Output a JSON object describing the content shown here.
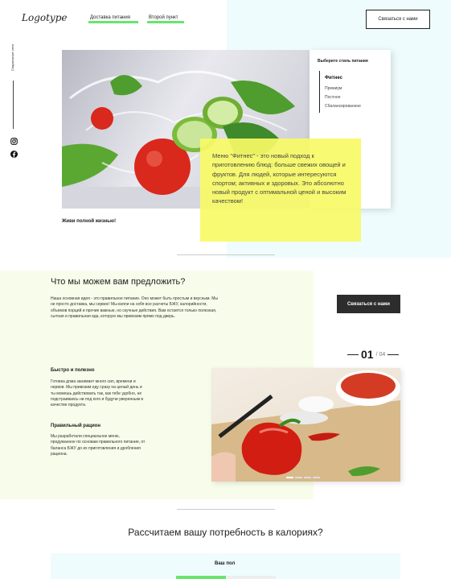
{
  "header": {
    "logo": "Logotype",
    "nav": [
      {
        "label": "Доставка питания"
      },
      {
        "label": "Второй пункт"
      }
    ],
    "contact_button": "Связаться с нами"
  },
  "sidebar": {
    "vertical_text": "Социальные сети",
    "social": [
      {
        "icon": "instagram-icon"
      },
      {
        "icon": "facebook-icon"
      }
    ]
  },
  "hero": {
    "panel_title": "Выберите стиль питания",
    "styles": [
      {
        "label": "Фитнес",
        "active": true
      },
      {
        "label": "Премиум",
        "active": false
      },
      {
        "label": "Постное",
        "active": false
      },
      {
        "label": "Сбалансированное",
        "active": false
      }
    ],
    "description": "Меню \"Фитнес\" - это новый подход к приготовлению блюд: больше свежих овощей и фруктов. Для людей, которые интересуются спортом; активных и здоровых. Это абсолютно новый продукт с оптимальной ценой и высоким качеством!",
    "tagline": "Живи полной жизнью!",
    "highlight_color": "#f7fa66"
  },
  "offer": {
    "title": "Что мы можем вам предложить?",
    "intro": "Наша основная идея - это правильное питание. Оно может быть простым и вкусным. Мы не просто доставка, мы сервис! Мы взяли на себя все расчеты БЖУ, калорийности, объемов порций и прочие важные, но скучные действия. Вам остается только полезная, сытная и правильная еда, которую мы привозим прямо под дверь.",
    "contact_button": "Связаться с нами",
    "blocks": [
      {
        "title": "Быстро и полезно",
        "text": "Готовка дома занимает много сил, времени и нервов. Мы привозим еду сразу на целый день и ты можешь действовать так, как тебе удобно, не подстраиваясь ни под кого и будучи уверенным в качестве продукта."
      },
      {
        "title": "Правильный рацион",
        "text": "Мы разработали специальное меню, продуманное по основам правильного питания, от баланса БЖУ до их приготовления и дробления рациона."
      }
    ],
    "slider": {
      "current": "01",
      "total": "/ 04",
      "slides": 4,
      "active_slide": 1
    }
  },
  "calories": {
    "title": "Рассчитаем вашу потребность в калориях?",
    "gender_label": "Ваш пол"
  },
  "colors": {
    "accent_green": "#69e56b",
    "cyan_bg": "#eefcfd",
    "lime_bg": "#f7fdea",
    "dark_button": "#2d2d2d"
  }
}
